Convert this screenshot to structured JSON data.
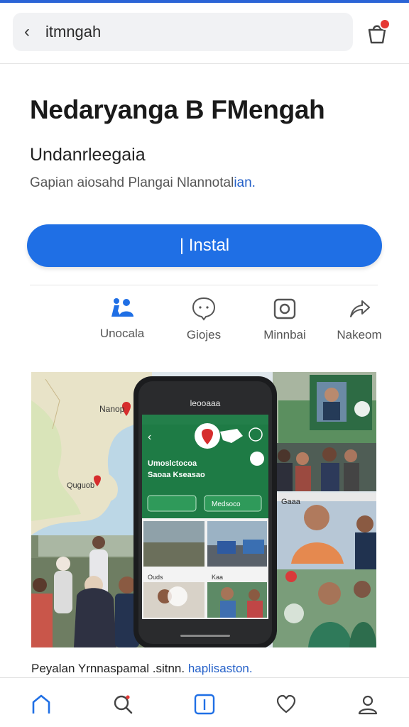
{
  "header": {
    "back_glyph": "‹",
    "search_query": "itmngah",
    "bag_icon": "shopping-bag-icon",
    "badge_color": "#e53935"
  },
  "app": {
    "title": "Nedaryanga B FMengah",
    "developer": "Undanrleegaia",
    "description_main": "Gapian aiosahd Plangai Nlannotal",
    "description_link": "ian.",
    "install_label": "| Instal",
    "accent": "#1f6fe5"
  },
  "actions": [
    {
      "label": "Unocala",
      "icon": "people-icon"
    },
    {
      "label": "Giojes",
      "icon": "chat-bubble-icon"
    },
    {
      "label": "Minnbai",
      "icon": "camera-icon"
    },
    {
      "label": "Nakeom",
      "icon": "share-icon"
    }
  ],
  "gallery": {
    "phone_header": "leooaaa",
    "phone_card_line1": "Umoslctocoa",
    "phone_card_line2": "Saoaa Kseasao",
    "phone_btn_2": "Medsoco",
    "map_label": "Nanop",
    "map_label2": "Quguob",
    "chip_left": "Ouds",
    "chip_right": "Kaa",
    "right_label": "Gaaa"
  },
  "caption": {
    "text": "Peyalan Yrnnaspamal .sitnn.",
    "link": "haplisaston."
  },
  "bottom_nav": [
    {
      "icon": "home-icon"
    },
    {
      "icon": "search-icon"
    },
    {
      "icon": "apps-icon"
    },
    {
      "icon": "heart-icon"
    },
    {
      "icon": "profile-icon"
    }
  ]
}
